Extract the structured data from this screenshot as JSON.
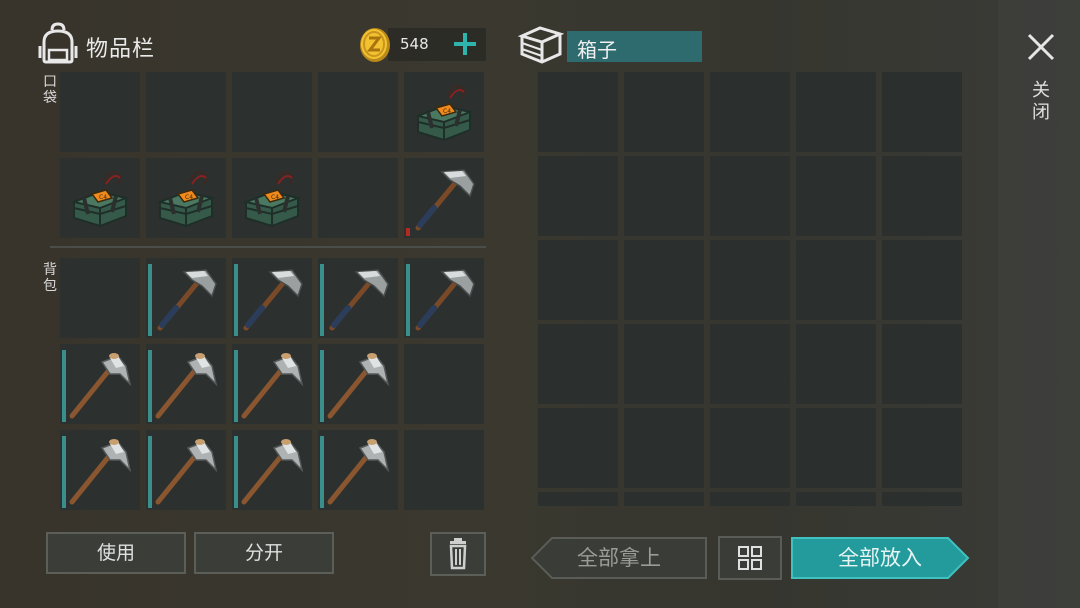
{
  "header": {
    "inventory_title": "物品栏",
    "coins": "548",
    "box_title": "箱子",
    "close_label": "关闭"
  },
  "inventory": {
    "pocket_label": "口袋",
    "backpack_label": "背包",
    "pocket_slots": [
      {
        "item": "empty"
      },
      {
        "item": "empty"
      },
      {
        "item": "empty"
      },
      {
        "item": "empty"
      },
      {
        "item": "c4-explosive-icon"
      },
      {
        "item": "c4-explosive-icon"
      },
      {
        "item": "c4-explosive-icon"
      },
      {
        "item": "c4-explosive-icon"
      },
      {
        "item": "empty"
      },
      {
        "item": "steel-pickaxe-icon",
        "durability": 0.1,
        "durability_color": "#b22a22"
      }
    ],
    "backpack_slots": [
      {
        "item": "empty"
      },
      {
        "item": "steel-pickaxe-icon",
        "durability": 0.95
      },
      {
        "item": "steel-pickaxe-icon",
        "durability": 0.95
      },
      {
        "item": "steel-pickaxe-icon",
        "durability": 0.95
      },
      {
        "item": "steel-pickaxe-icon",
        "durability": 0.95
      },
      {
        "item": "stone-pickaxe-icon",
        "durability": 0.95
      },
      {
        "item": "stone-pickaxe-icon",
        "durability": 0.95
      },
      {
        "item": "stone-pickaxe-icon",
        "durability": 0.95
      },
      {
        "item": "stone-pickaxe-icon",
        "durability": 0.95
      },
      {
        "item": "empty"
      },
      {
        "item": "stone-pickaxe-icon",
        "durability": 0.95
      },
      {
        "item": "stone-pickaxe-icon",
        "durability": 0.95
      },
      {
        "item": "stone-pickaxe-icon",
        "durability": 0.95
      },
      {
        "item": "stone-pickaxe-icon",
        "durability": 0.95
      },
      {
        "item": "empty"
      }
    ]
  },
  "buttons": {
    "use": "使用",
    "split": "分开",
    "take_all": "全部拿上",
    "put_all": "全部放入"
  },
  "colors": {
    "accent_teal": "#2d6b6e",
    "button_teal": "#239b9c",
    "durability_teal": "#3a8f8c",
    "durability_low": "#b22a22"
  }
}
